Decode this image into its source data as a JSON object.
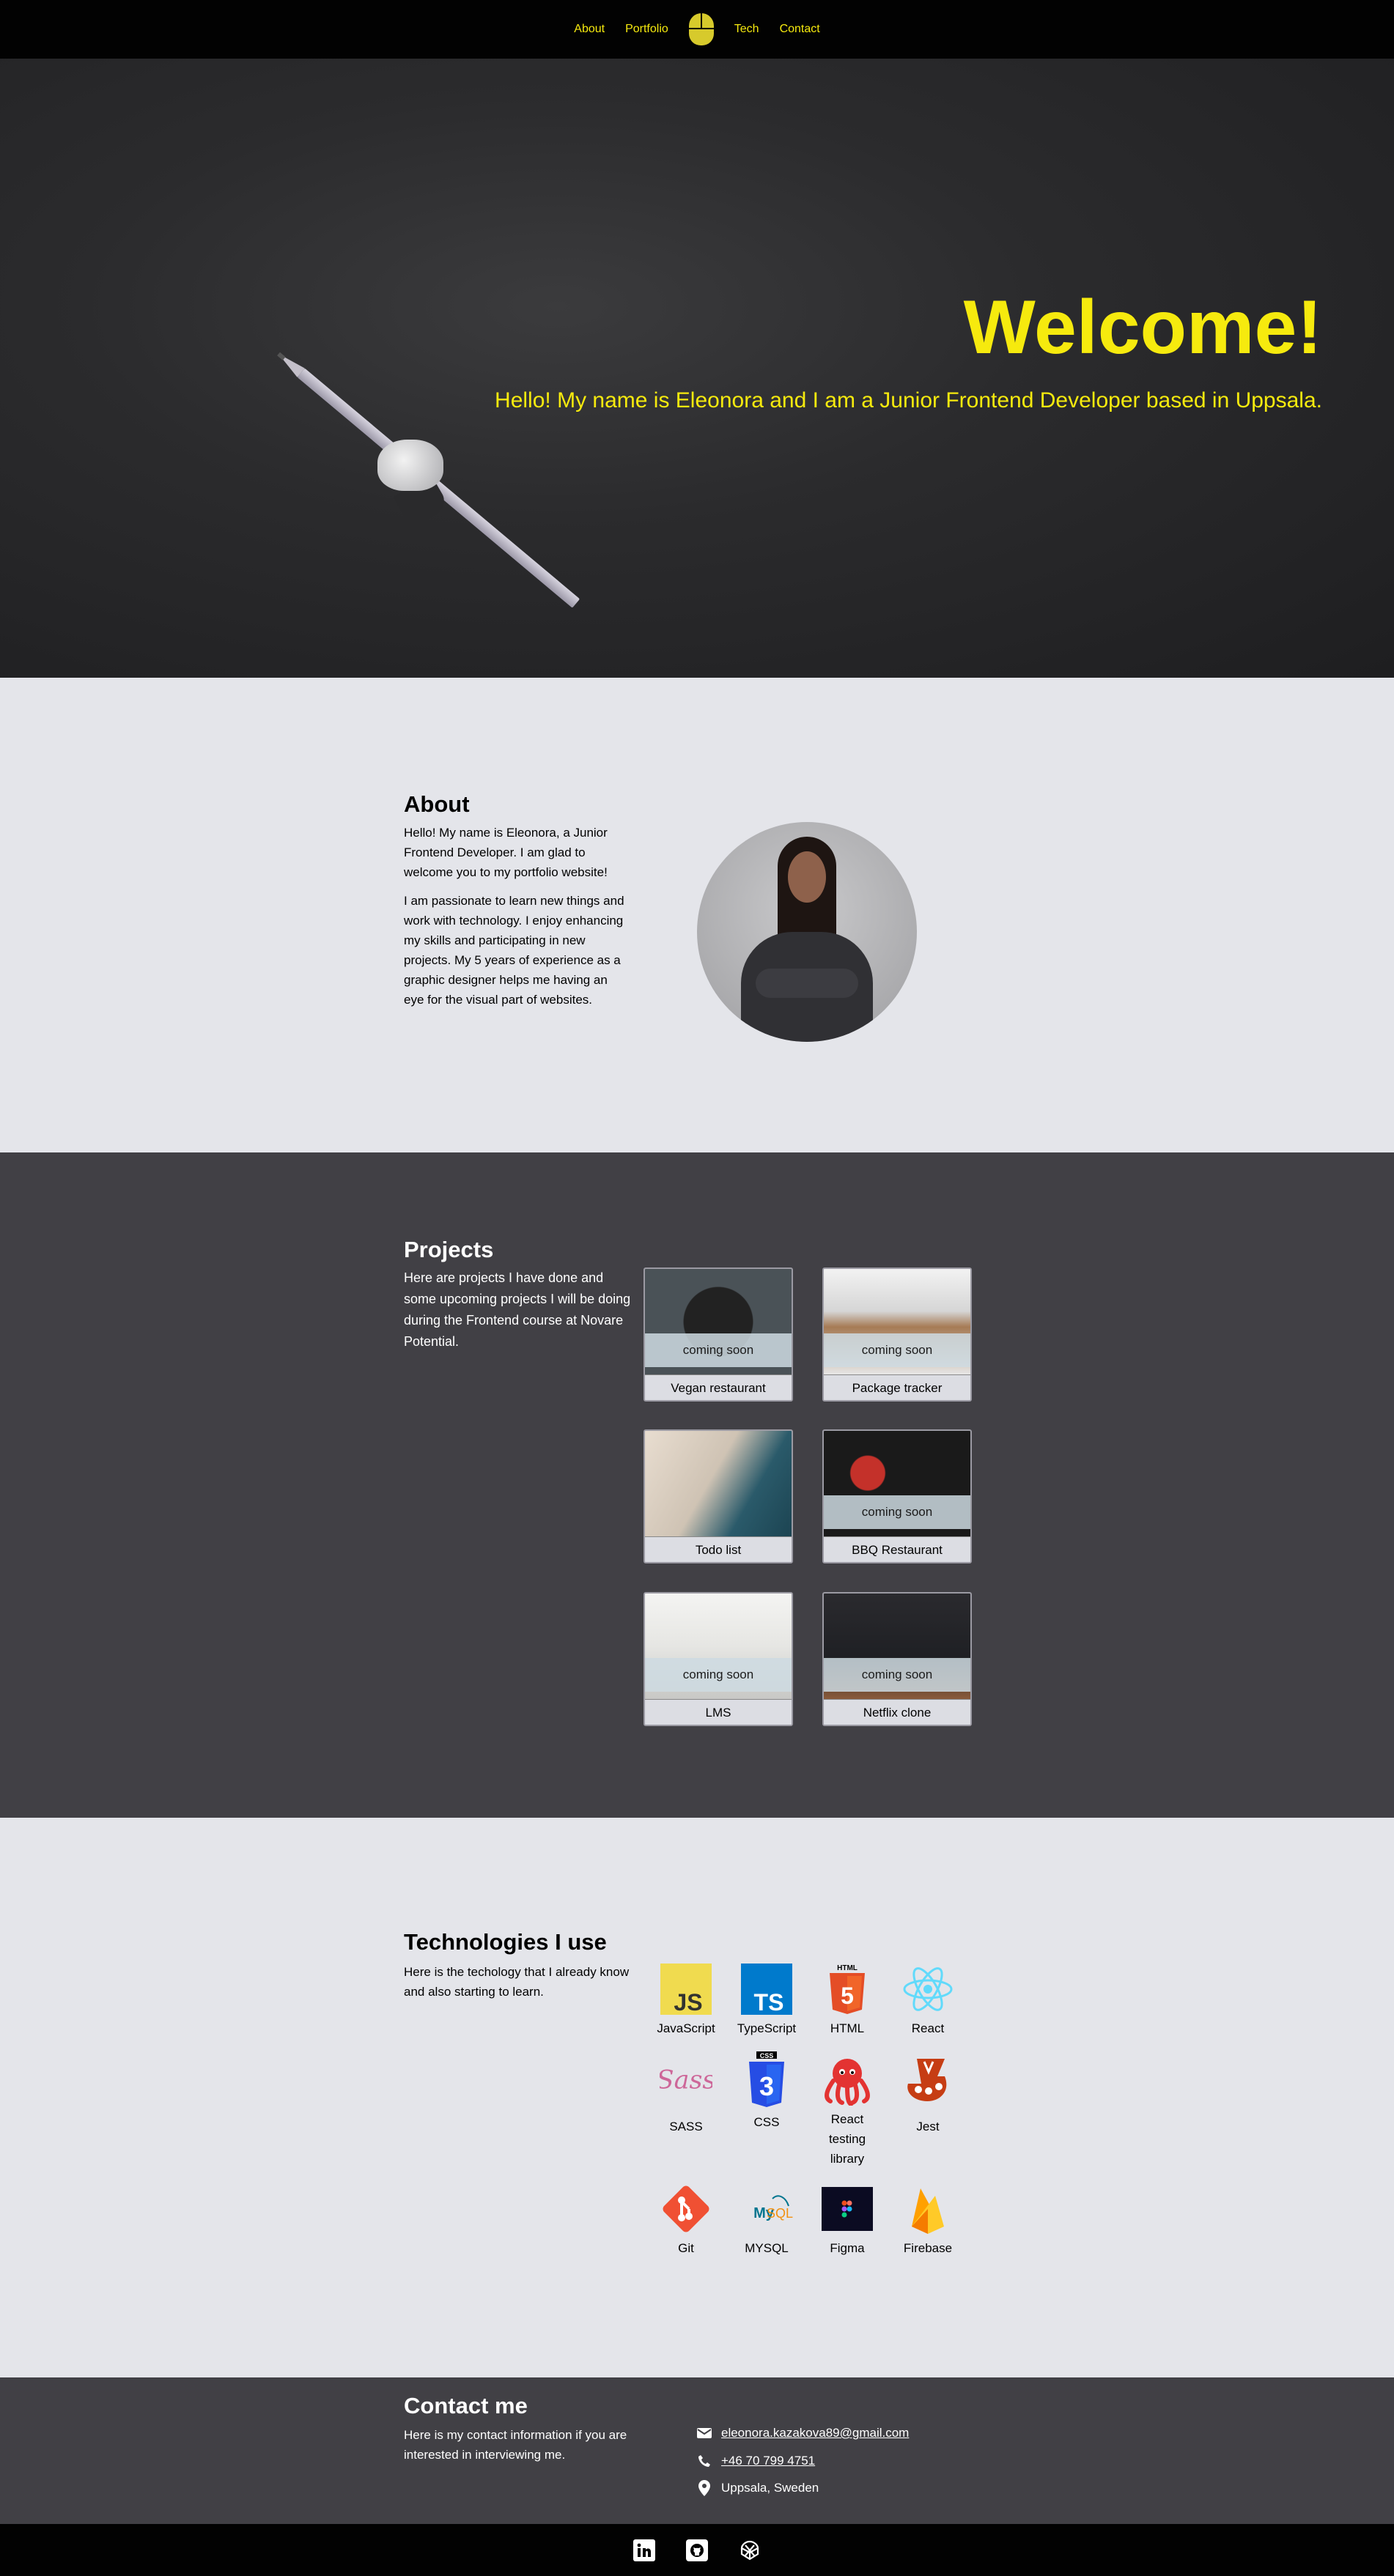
{
  "nav": {
    "links": [
      "About",
      "Portfolio",
      "Tech",
      "Contact"
    ],
    "logo_icon": "computer-mouse-icon",
    "color": "#f6ea0e"
  },
  "hero": {
    "title": "Welcome!",
    "subtitle": "Hello! My name is Eleonora and I am a Junior Frontend Developer based in Uppsala."
  },
  "about": {
    "title": "About",
    "paragraphs": [
      "Hello! My name is Eleonora, a Junior Frontend Developer. I am glad to welcome you to my portfolio website!",
      "I am passionate to learn new things and work with technology. I enjoy enhancing my skills and participating in new projects. My 5 years of experience as a graphic designer helps me having an eye for the visual part of websites."
    ]
  },
  "projects": {
    "title": "Projects",
    "intro": "Here are projects I have done and some upcoming projects I will be doing during the Frontend course at Novare Potential.",
    "items": [
      {
        "name": "Vegan restaurant",
        "badge": "coming soon"
      },
      {
        "name": "Package tracker",
        "badge": "coming soon"
      },
      {
        "name": "Todo list",
        "badge": ""
      },
      {
        "name": "BBQ Restaurant",
        "badge": "coming soon"
      },
      {
        "name": "LMS",
        "badge": "coming soon"
      },
      {
        "name": "Netflix clone",
        "badge": "coming soon"
      }
    ]
  },
  "tech": {
    "title": "Technologies I use",
    "intro": "Here is the techology that I already know and also starting to learn.",
    "items": [
      {
        "label": "JavaScript",
        "icon": "javascript-icon"
      },
      {
        "label": "TypeScript",
        "icon": "typescript-icon"
      },
      {
        "label": "HTML",
        "icon": "html5-icon"
      },
      {
        "label": "React",
        "icon": "react-icon"
      },
      {
        "label": "SASS",
        "icon": "sass-icon"
      },
      {
        "label": "CSS",
        "icon": "css3-icon"
      },
      {
        "label": "React testing library",
        "icon": "octopus-icon"
      },
      {
        "label": "Jest",
        "icon": "jest-icon"
      },
      {
        "label": "Git",
        "icon": "git-icon"
      },
      {
        "label": "MYSQL",
        "icon": "mysql-icon"
      },
      {
        "label": "Figma",
        "icon": "figma-icon"
      },
      {
        "label": "Firebase",
        "icon": "firebase-icon"
      }
    ]
  },
  "contact": {
    "title": "Contact me",
    "intro": "Here is my contact information if you are interested in interviewing me.",
    "email": "eleonora.kazakova89@gmail.com",
    "phone": "+46 70 799 4751",
    "location": "Uppsala, Sweden"
  },
  "footer": {
    "icons": [
      "linkedin-icon",
      "github-icon",
      "codepen-icon"
    ]
  }
}
